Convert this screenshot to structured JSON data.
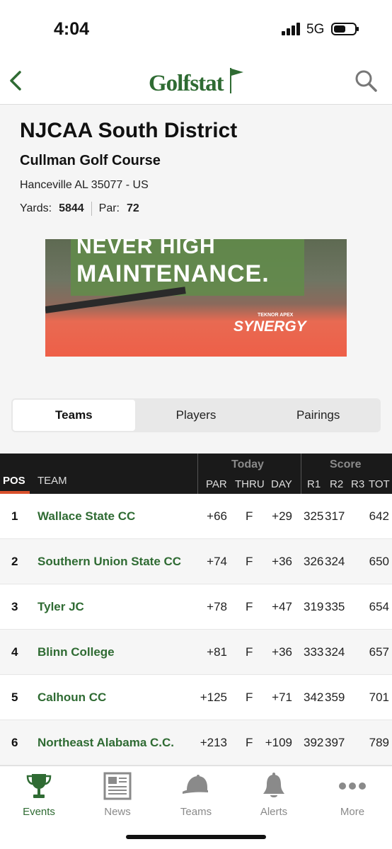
{
  "status_bar": {
    "time": "4:04",
    "network": "5G"
  },
  "nav": {
    "logo": "Golfstat"
  },
  "event": {
    "title": "NJCAA South District",
    "course": "Cullman Golf Course",
    "address": "Hanceville AL  35077 - US",
    "yards_label": "Yards:",
    "yards": "5844",
    "par_label": "Par:",
    "par": "72"
  },
  "ad": {
    "line1": "NEVER HIGH",
    "line2": "MAINTENANCE.",
    "brand_small": "TEKNOR APEX",
    "brand": "SYNERGY"
  },
  "tabs": [
    "Teams",
    "Players",
    "Pairings"
  ],
  "active_tab": 0,
  "table": {
    "pos_header": "POS",
    "team_header": "TEAM",
    "today_header": "Today",
    "score_header": "Score",
    "sub_headers": {
      "par": "PAR",
      "thru": "THRU",
      "day": "DAY",
      "r1": "R1",
      "r2": "R2",
      "r3": "R3",
      "tot": "TOT"
    },
    "rows": [
      {
        "pos": "1",
        "team": "Wallace State CC",
        "par": "+66",
        "thru": "F",
        "day": "+29",
        "r1": "325",
        "r2": "317",
        "tot": "642"
      },
      {
        "pos": "2",
        "team": "Southern Union State CC",
        "par": "+74",
        "thru": "F",
        "day": "+36",
        "r1": "326",
        "r2": "324",
        "tot": "650"
      },
      {
        "pos": "3",
        "team": "Tyler JC",
        "par": "+78",
        "thru": "F",
        "day": "+47",
        "r1": "319",
        "r2": "335",
        "tot": "654"
      },
      {
        "pos": "4",
        "team": "Blinn College",
        "par": "+81",
        "thru": "F",
        "day": "+36",
        "r1": "333",
        "r2": "324",
        "tot": "657"
      },
      {
        "pos": "5",
        "team": "Calhoun CC",
        "par": "+125",
        "thru": "F",
        "day": "+71",
        "r1": "342",
        "r2": "359",
        "tot": "701"
      },
      {
        "pos": "6",
        "team": "Northeast Alabama C.C.",
        "par": "+213",
        "thru": "F",
        "day": "+109",
        "r1": "392",
        "r2": "397",
        "tot": "789"
      }
    ]
  },
  "tabbar": {
    "items": [
      {
        "label": "Events",
        "icon": "trophy-icon"
      },
      {
        "label": "News",
        "icon": "newspaper-icon"
      },
      {
        "label": "Teams",
        "icon": "cap-icon"
      },
      {
        "label": "Alerts",
        "icon": "bell-icon"
      },
      {
        "label": "More",
        "icon": "more-icon"
      }
    ],
    "active": 0
  },
  "colors": {
    "accent": "#2f6b33",
    "header_bg": "#1a1a1a",
    "pos_underline": "#d9512c"
  }
}
